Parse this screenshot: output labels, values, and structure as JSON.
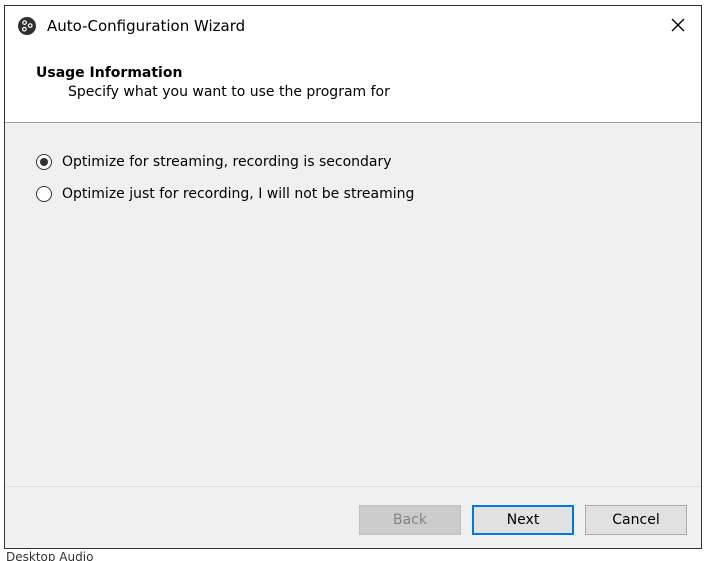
{
  "window": {
    "title": "Auto-Configuration Wizard",
    "app_icon": "obs-logo-icon",
    "close_icon": "close-icon"
  },
  "header": {
    "title": "Usage Information",
    "subtitle": "Specify what you want to use the program for"
  },
  "options": [
    {
      "label": "Optimize for streaming, recording is secondary",
      "selected": true
    },
    {
      "label": "Optimize just for recording, I will not be streaming",
      "selected": false
    }
  ],
  "buttons": {
    "back": {
      "label": "Back",
      "enabled": false
    },
    "next": {
      "label": "Next",
      "enabled": true
    },
    "cancel": {
      "label": "Cancel",
      "enabled": true
    }
  },
  "background": {
    "partial_text": "Desktop Audio"
  },
  "colors": {
    "accent": "#0078d7",
    "dialog_bg": "#f0f0f0",
    "header_bg": "#ffffff"
  }
}
